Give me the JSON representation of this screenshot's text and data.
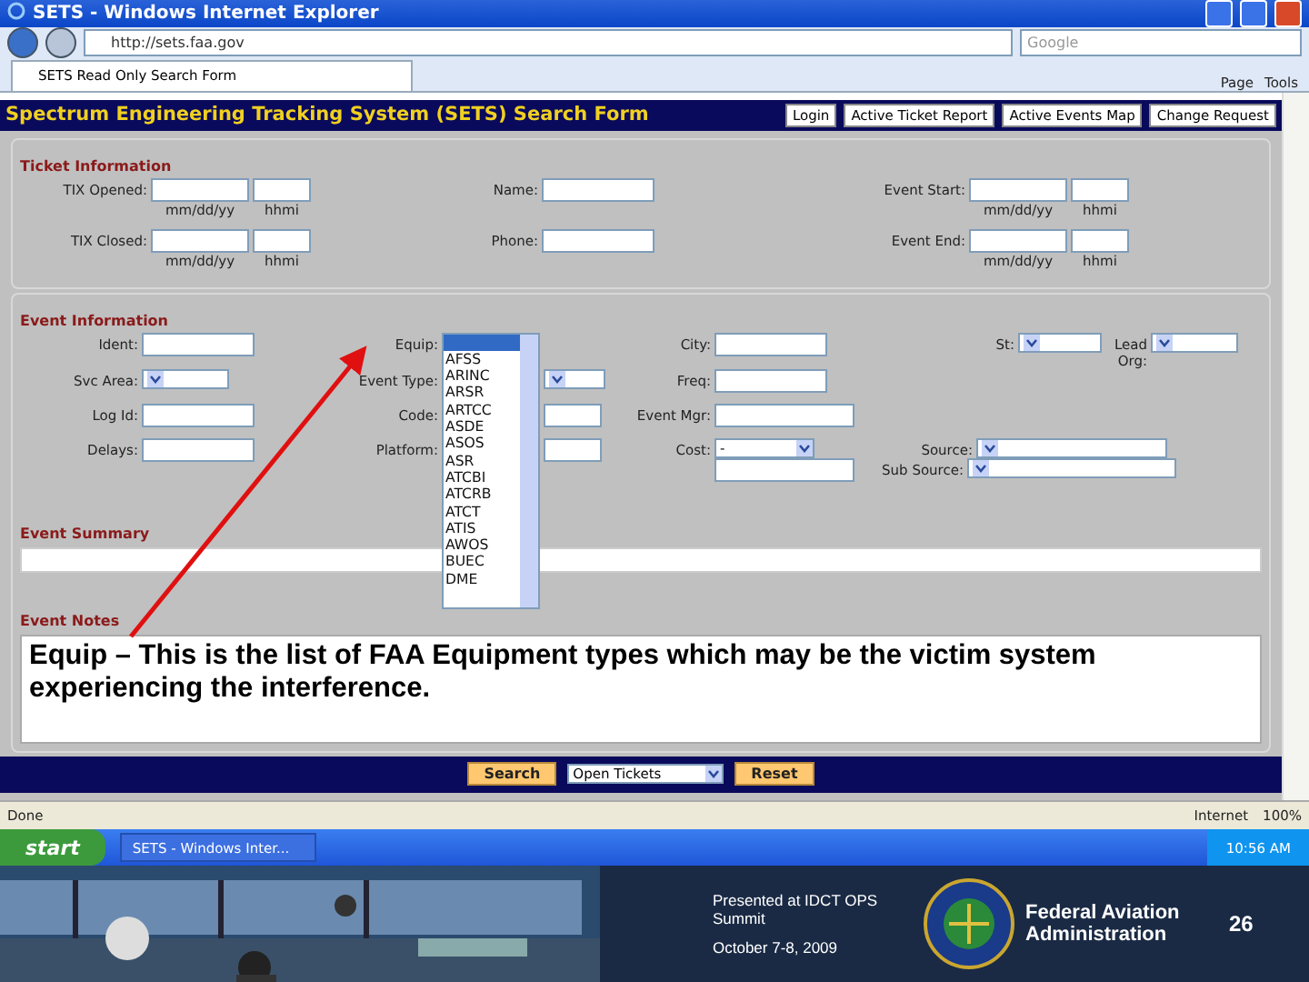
{
  "window": {
    "title": "SETS - Windows Internet Explorer"
  },
  "address_bar": {
    "url": "http://sets.faa.gov",
    "search_placeholder": "Google"
  },
  "tabs": [
    {
      "label": "SETS Read Only Search Form",
      "selected": true
    }
  ],
  "command_bar": [
    "Page",
    "Tools"
  ],
  "page": {
    "title": "Spectrum Engineering Tracking System (SETS) Search Form",
    "nav_buttons": [
      "Login",
      "Active Ticket Report",
      "Active Events Map",
      "Change Request"
    ],
    "ticket_section": {
      "title": "Ticket Information",
      "rows": [
        {
          "fields": [
            {
              "kind": "datetime",
              "label": "TIX Opened:",
              "date_hint": "mm/dd/yy",
              "time_hint": "hhmi"
            },
            {
              "kind": "text",
              "label": "Name:"
            },
            {
              "kind": "datetime",
              "label": "Event Start:",
              "date_hint": "mm/dd/yy",
              "time_hint": "hhmi"
            }
          ]
        },
        {
          "fields": [
            {
              "kind": "datetime",
              "label": "TIX Closed:",
              "date_hint": "mm/dd/yy",
              "time_hint": "hhmi"
            },
            {
              "kind": "text",
              "label": "Phone:"
            },
            {
              "kind": "datetime",
              "label": "Event End:",
              "date_hint": "mm/dd/yy",
              "time_hint": "hhmi"
            }
          ]
        }
      ]
    },
    "event_section": {
      "title": "Event Information",
      "rows": [
        {
          "fields": [
            {
              "kind": "text",
              "label": "Ident:"
            },
            {
              "kind": "list",
              "label": "Equip:"
            },
            {
              "kind": "text",
              "label": "City:"
            },
            {
              "kind": "select",
              "label": "St:"
            },
            {
              "kind": "select",
              "label": "Lead Org:"
            }
          ]
        },
        {
          "fields": [
            {
              "kind": "select",
              "label": "Svc Area:"
            },
            {
              "kind": "select",
              "label": "Event Type:"
            },
            {
              "kind": "text",
              "label": "Freq:"
            }
          ]
        },
        {
          "fields": [
            {
              "kind": "text",
              "label": "Log Id:"
            },
            {
              "kind": "text",
              "label": "Code:"
            },
            {
              "kind": "text",
              "label": "Event Mgr:"
            }
          ]
        },
        {
          "fields": [
            {
              "kind": "text",
              "label": "Delays:"
            },
            {
              "kind": "text",
              "label": "Platform:"
            },
            {
              "kind": "cost",
              "label": "Cost:",
              "value": "-"
            },
            {
              "kind": "source",
              "label": "Source:",
              "sub_label": "Sub Source:"
            }
          ]
        }
      ]
    },
    "equip_list": {
      "first_highlighted": true,
      "items": [
        "AFSS",
        "ARINC",
        "ARSR",
        "ARTCC",
        "ASDE",
        "ASOS",
        "ASR",
        "ATCBI",
        "ATCRB",
        "ATCT",
        "ATIS",
        "AWOS",
        "BUEC",
        "DME"
      ]
    },
    "summary": {
      "title": "Event Summary"
    },
    "notes": {
      "title": "Event Notes",
      "value": "Equip – This is the list of FAA Equipment types which may be the victim system experiencing the interference."
    },
    "actions": {
      "search": "Search",
      "filter": "Open Tickets",
      "reset": "Reset"
    }
  },
  "status_bar": {
    "status": "Done",
    "zone": "Internet",
    "zoom": "100%"
  },
  "taskbar": {
    "start": "start",
    "window": "SETS - Windows Inter...",
    "clock": "10:56 AM"
  },
  "footer": {
    "presented": "Presented at IDCT OPS Summit",
    "date": "October 7-8, 2009",
    "agency": "Federal Aviation Administration",
    "slide_number": "26"
  }
}
